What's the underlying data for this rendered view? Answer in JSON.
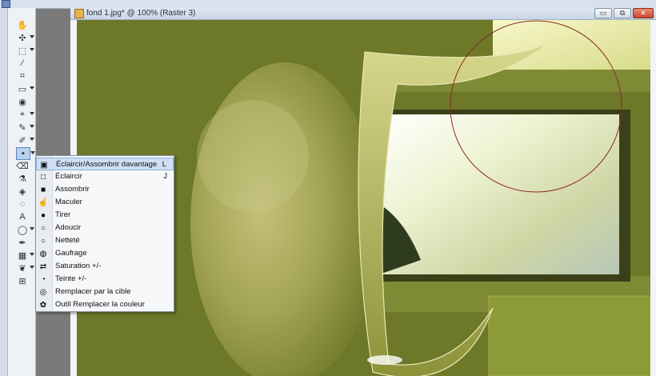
{
  "document": {
    "title": "fond 1.jpg* @ 100% (Raster 3)",
    "buttons": {
      "minimize": "▭",
      "restore": "⧉",
      "close": "✕"
    }
  },
  "toolbar": {
    "tools": [
      {
        "name": "pan-tool",
        "glyph": "✋"
      },
      {
        "name": "move-tool",
        "glyph": "✣"
      },
      {
        "name": "selection-tool",
        "glyph": "⬚"
      },
      {
        "name": "dropper-tool",
        "glyph": "⁄"
      },
      {
        "name": "crop-tool",
        "glyph": "⌗"
      },
      {
        "name": "object-selection-tool",
        "glyph": "▭"
      },
      {
        "name": "red-eye-tool",
        "glyph": "◉"
      },
      {
        "name": "makeover-tool",
        "glyph": "⌖"
      },
      {
        "name": "clone-tool",
        "glyph": "✎"
      },
      {
        "name": "paint-brush-tool",
        "glyph": "✐"
      },
      {
        "name": "dodge-burn-tool",
        "glyph": "▪"
      },
      {
        "name": "eraser-tool",
        "glyph": "⌫"
      },
      {
        "name": "color-replacer-tool",
        "glyph": "⚗"
      },
      {
        "name": "flood-fill-tool",
        "glyph": "◈"
      },
      {
        "name": "airbrush-tool",
        "glyph": "◌"
      },
      {
        "name": "text-tool",
        "glyph": "A"
      },
      {
        "name": "preset-shape-tool",
        "glyph": "◯"
      },
      {
        "name": "pen-tool",
        "glyph": "✒"
      },
      {
        "name": "warp-brush-tool",
        "glyph": "▦"
      },
      {
        "name": "picture-tube-tool",
        "glyph": "❦"
      },
      {
        "name": "mesh-warp-tool",
        "glyph": "⊞"
      }
    ]
  },
  "flyout": {
    "items": [
      {
        "label": "Éclaircir/Assombrir davantage",
        "shortcut": "L",
        "icon": "dodge-burn-icon",
        "glyph": "▣",
        "selected": true
      },
      {
        "label": "Éclaircir",
        "shortcut": "J",
        "icon": "dodge-icon",
        "glyph": "□"
      },
      {
        "label": "Assombrir",
        "shortcut": "",
        "icon": "burn-icon",
        "glyph": "■"
      },
      {
        "label": "Maculer",
        "shortcut": "",
        "icon": "smudge-icon",
        "glyph": "☝"
      },
      {
        "label": "Tirer",
        "shortcut": "",
        "icon": "push-icon",
        "glyph": "●"
      },
      {
        "label": "Adoucir",
        "shortcut": "",
        "icon": "soften-icon",
        "glyph": "○"
      },
      {
        "label": "Netteté",
        "shortcut": "",
        "icon": "sharpen-icon",
        "glyph": "○"
      },
      {
        "label": "Gaufrage",
        "shortcut": "",
        "icon": "emboss-icon",
        "glyph": "◍"
      },
      {
        "label": "Saturation +/-",
        "shortcut": "",
        "icon": "saturation-icon",
        "glyph": "⇄"
      },
      {
        "label": "Teinte +/-",
        "shortcut": "",
        "icon": "hue-icon",
        "glyph": "◔"
      },
      {
        "label": "Remplacer par la cible",
        "shortcut": "",
        "icon": "change-to-target-icon",
        "glyph": "◎"
      },
      {
        "label": "Outil Remplacer la couleur",
        "shortcut": "",
        "icon": "color-replacer-icon",
        "glyph": "✿"
      }
    ]
  },
  "colors": {
    "accent": "#5b86c0",
    "canvas_olive": "#6b7629",
    "highlight": "#cfe0f5"
  }
}
